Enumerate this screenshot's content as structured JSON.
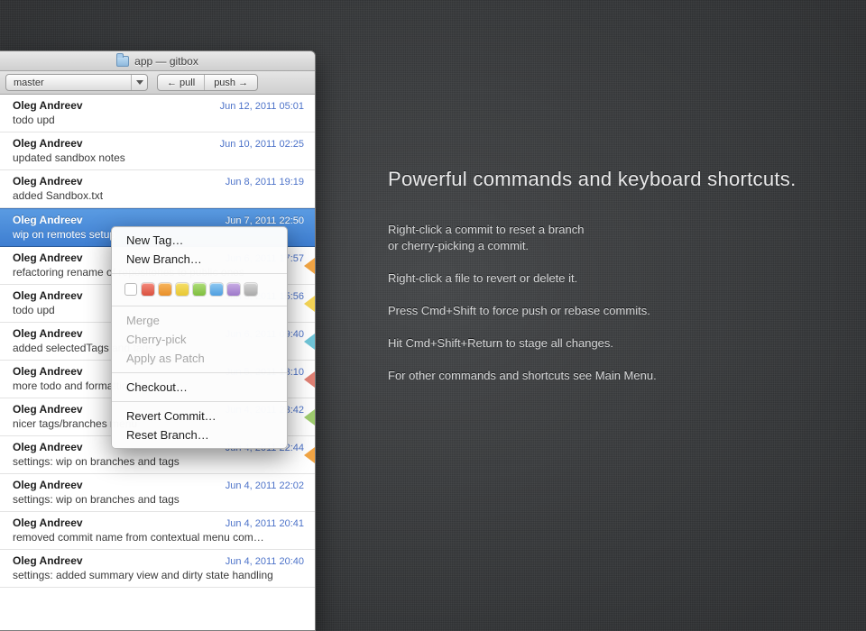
{
  "copy": {
    "heading": "Powerful commands and keyboard shortcuts.",
    "p1a": "Right-click a commit to reset a branch",
    "p1b": "or cherry-picking a commit.",
    "p2": "Right-click a file to revert or delete it.",
    "p3": "Press Cmd+Shift to force push or rebase commits.",
    "p4": "Hit Cmd+Shift+Return to stage all changes.",
    "p5": "For other commands and shortcuts see Main Menu."
  },
  "window": {
    "title": "app — gitbox",
    "branch": "master",
    "pull_label": "← pull",
    "push_label": "push →"
  },
  "commits": [
    {
      "author": "Oleg Andreev",
      "date": "Jun 12, 2011 05:01",
      "msg": "todo upd",
      "tag": ""
    },
    {
      "author": "Oleg Andreev",
      "date": "Jun 10, 2011 02:25",
      "msg": "updated sandbox notes",
      "tag": ""
    },
    {
      "author": "Oleg Andreev",
      "date": "Jun 8, 2011 19:19",
      "msg": "added Sandbox.txt",
      "tag": ""
    },
    {
      "author": "Oleg Andreev",
      "date": "Jun 7, 2011 22:50",
      "msg": "wip on remotes setup",
      "tag": "",
      "selected": true
    },
    {
      "author": "Oleg Andreev",
      "date": "Jun 6, 2011 17:57",
      "msg": "refactoring rename of repositories to public ones",
      "tag": "orange"
    },
    {
      "author": "Oleg Andreev",
      "date": "Jun 6, 2011 15:56",
      "msg": "todo upd",
      "tag": "yellow"
    },
    {
      "author": "Oleg Andreev",
      "date": "Jun 6, 2011 09:40",
      "msg": "added selectedTags and tags",
      "tag": "cyan"
    },
    {
      "author": "Oleg Andreev",
      "date": "Jun 5, 2011 13:10",
      "msg": "more todo and formatting fix",
      "tag": "red"
    },
    {
      "author": "Oleg Andreev",
      "date": "Jun 4, 2011 23:42",
      "msg": "nicer tags/branches menu",
      "tag": "green"
    },
    {
      "author": "Oleg Andreev",
      "date": "Jun 4, 2011 22:44",
      "msg": "settings: wip on branches and tags",
      "tag": "orange"
    },
    {
      "author": "Oleg Andreev",
      "date": "Jun 4, 2011 22:02",
      "msg": "settings: wip on branches and tags",
      "tag": ""
    },
    {
      "author": "Oleg Andreev",
      "date": "Jun 4, 2011 20:41",
      "msg": "removed commit name from contextual menu com…",
      "tag": ""
    },
    {
      "author": "Oleg Andreev",
      "date": "Jun 4, 2011 20:40",
      "msg": "settings: added summary view and dirty state handling",
      "tag": ""
    }
  ],
  "menu": {
    "new_tag": "New Tag…",
    "new_branch": "New Branch…",
    "merge": "Merge",
    "cherry_pick": "Cherry-pick",
    "apply_patch": "Apply as Patch",
    "checkout": "Checkout…",
    "revert_commit": "Revert Commit…",
    "reset_branch": "Reset Branch…",
    "swatches": [
      "none",
      "red",
      "orange",
      "yellow",
      "green",
      "blue",
      "purple",
      "gray"
    ]
  }
}
